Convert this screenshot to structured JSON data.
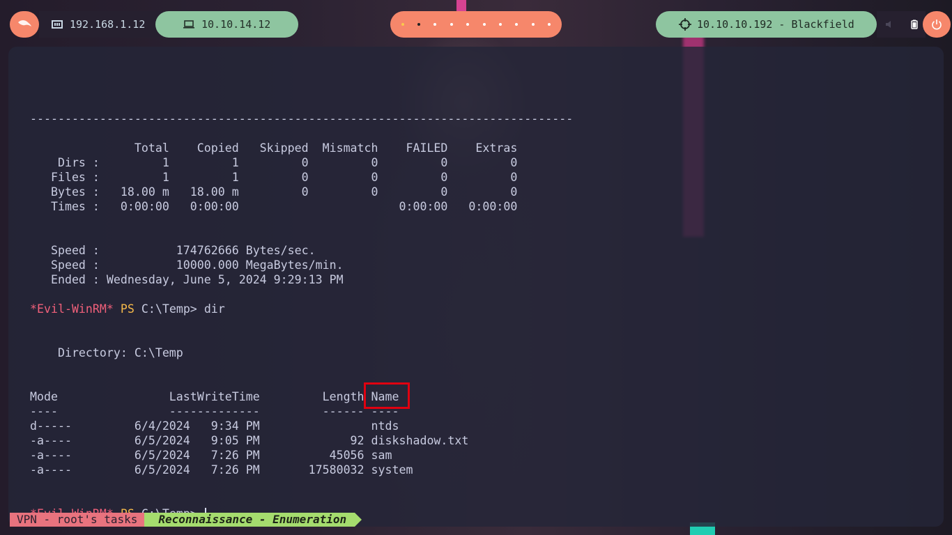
{
  "topbar": {
    "left_ip": "192.168.1.12",
    "vpn_ip": "10.10.14.12",
    "target": "10.10.10.192 - Blackfield",
    "workspaces": [
      "ws1",
      "ws2",
      "ws3",
      "ws4",
      "ws5",
      "ws6",
      "ws7",
      "ws8",
      "ws9",
      "ws10"
    ]
  },
  "terminal": {
    "lines": [
      "",
      "",
      "------------------------------------------------------------------------------",
      "",
      "               Total    Copied   Skipped  Mismatch    FAILED    Extras",
      "    Dirs :         1         1         0         0         0         0",
      "   Files :         1         1         0         0         0         0",
      "   Bytes :   18.00 m   18.00 m         0         0         0         0",
      "   Times :   0:00:00   0:00:00                       0:00:00   0:00:00",
      "",
      "",
      "   Speed :           174762666 Bytes/sec.",
      "   Speed :           10000.000 MegaBytes/min.",
      "   Ended : Wednesday, June 5, 2024 9:29:13 PM",
      ""
    ],
    "prompt_user": "*Evil-WinRM*",
    "prompt_ps": "PS",
    "prompt_path": "C:\\Temp>",
    "command1": "dir",
    "dir_listing": [
      "",
      "",
      "    Directory: C:\\Temp",
      "",
      "",
      "Mode                LastWriteTime         Length Name",
      "----                -------------         ------ ----",
      "d-----         6/4/2024   9:34 PM                ntds",
      "-a----         6/5/2024   9:05 PM             92 diskshadow.txt",
      "-a----         6/5/2024   7:26 PM          45056 sam",
      "-a----         6/5/2024   7:26 PM       17580032 system",
      "",
      ""
    ]
  },
  "statusbar": {
    "session": "VPN - root's tasks",
    "window": "Reconnaissance - Enumeration"
  },
  "colors": {
    "accent_orange": "#f6876b",
    "accent_green": "#8ec5a0",
    "prompt_red": "#f0607a",
    "prompt_yellow": "#f5b94a",
    "highlight_box": "#e00010"
  }
}
